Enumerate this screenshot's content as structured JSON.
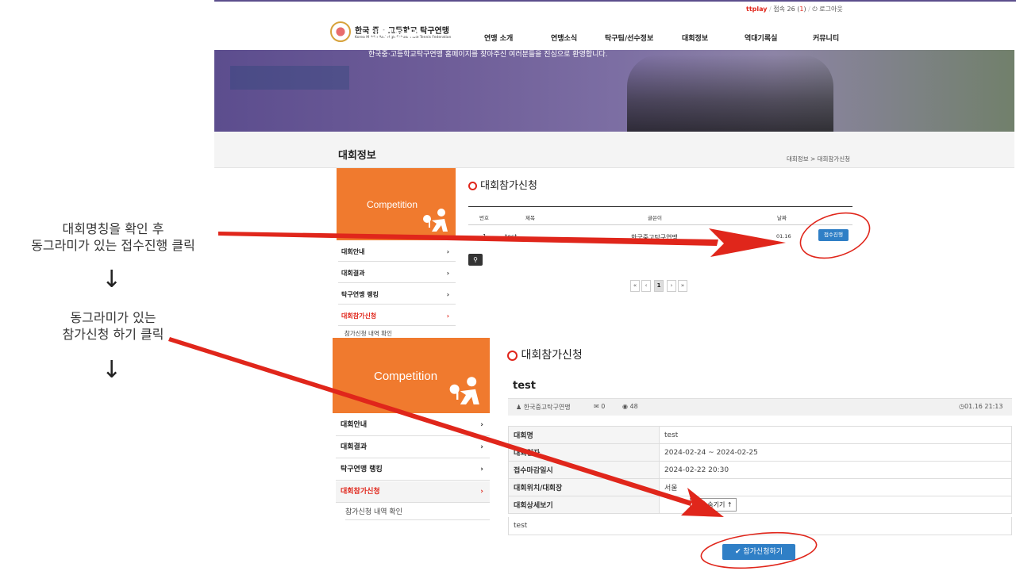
{
  "instructions": {
    "step1_line1": "대회명칭을 확인 후",
    "step1_line2": "동그라미가 있는 접수진행 클릭",
    "arrow1": "↓",
    "step2_line1": "동그라미가 있는",
    "step2_line2": "참가신청 하기 클릭",
    "arrow2": "↓"
  },
  "top": {
    "util": {
      "brand": "ttplay",
      "sep": "/",
      "visitors_label": "접속 26 (",
      "visitors_now": "1",
      "visitors_close": ")",
      "logout": "로그아웃",
      "logout_icon": "power-icon"
    },
    "logo": {
      "title": "한국 중 · 고등학교 탁구연맹",
      "subtitle": "Korea Middle And High School Table Tennis Federation"
    },
    "nav": [
      "연맹 소개",
      "연맹소식",
      "탁구팀/선수정보",
      "대회정보",
      "역대기록실",
      "커뮤니티"
    ],
    "banner": {
      "title": "대회정보",
      "subtitle": "한국중·고등학교탁구연맹 홈페이지를 찾아주신 여러분들을 진심으로 환영합니다."
    },
    "section_title": "대회정보",
    "breadcrumb": "대회정보 > 대회참가신청",
    "sidebar": {
      "title": "Competition",
      "items": [
        "대회안내",
        "대회결과",
        "탁구연맹 랭킹",
        "대회참가신청"
      ],
      "sub": "참가신청 내역 확인",
      "chev": "›"
    },
    "board": {
      "title": "대회참가신청",
      "headers": [
        "번호",
        "제목",
        "글쓴이",
        "날짜"
      ],
      "row": {
        "no": "1",
        "title": "test",
        "author": "한국중고탁구연맹",
        "date": "01.16",
        "action": "접수진행"
      },
      "search_icon": "search-icon",
      "pager": [
        "«",
        "‹",
        "1",
        "›",
        "»"
      ]
    }
  },
  "bottom": {
    "board_title": "대회참가신청",
    "sidebar": {
      "title": "Competition",
      "items": [
        "대회안내",
        "대회결과",
        "탁구연맹 랭킹",
        "대회참가신청"
      ],
      "sub": "참가신청 내역 확인",
      "chev": "›"
    },
    "post": {
      "title": "test",
      "author": "한국중고탁구연맹",
      "comments": "0",
      "views": "48",
      "datetime": "01.16 21:13"
    },
    "fields": [
      {
        "k": "대회명",
        "v": "test"
      },
      {
        "k": "대회일자",
        "v": "2024-02-24 ~ 2024-02-25"
      },
      {
        "k": "접수마감일시",
        "v": "2024-02-22 20:30"
      },
      {
        "k": "대회위치/대회장",
        "v": "서울"
      },
      {
        "k": "대회상세보기",
        "v": "보기 숨기기 ↑"
      }
    ],
    "body": "test",
    "apply_button": "✔ 참가신청하기"
  },
  "colors": {
    "accent": "#f07a2e",
    "link_blue": "#2f7fc6",
    "annotation_red": "#e0261b"
  }
}
